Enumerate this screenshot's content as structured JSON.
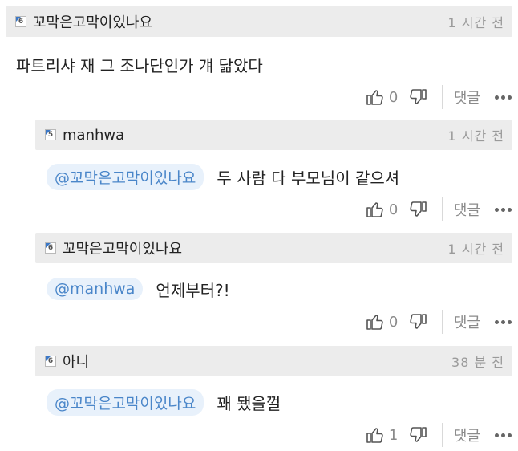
{
  "comments": [
    {
      "level": "6",
      "nickname": "꼬막은고막이있나요",
      "time": "1 시간 전",
      "mention": "",
      "text": "파트리샤 재 그 조나단인가 걔 닮았다",
      "up_count": "0",
      "reply_label": "댓글"
    },
    {
      "level": "5",
      "nickname": "manhwa",
      "time": "1 시간 전",
      "mention": "@꼬막은고막이있나요",
      "text": "두 사람 다 부모님이 같으셔",
      "up_count": "0",
      "reply_label": "댓글"
    },
    {
      "level": "6",
      "nickname": "꼬막은고막이있나요",
      "time": "1 시간 전",
      "mention": "@manhwa",
      "text": "언제부터?!",
      "up_count": "0",
      "reply_label": "댓글"
    },
    {
      "level": "6",
      "nickname": "아니",
      "time": "38 분 전",
      "mention": "@꼬막은고막이있나요",
      "text": "꽤 됐을껄",
      "up_count": "1",
      "reply_label": "댓글"
    }
  ],
  "icons": {
    "thumb_up": "thumbs-up-icon",
    "thumb_down": "thumbs-down-icon",
    "more": "more-dots-icon",
    "level": "level-badge-icon"
  }
}
